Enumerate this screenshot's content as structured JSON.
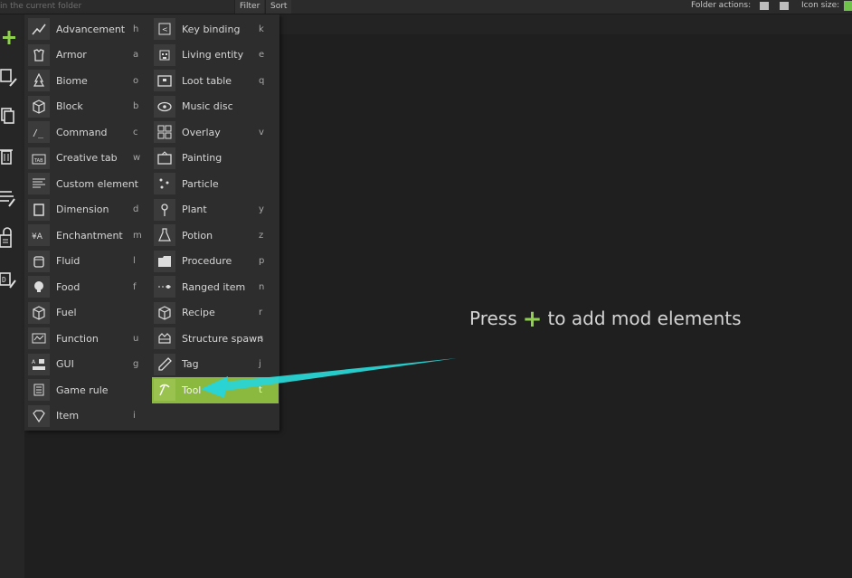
{
  "topbar": {
    "search_placeholder": "in the current folder",
    "filter_label": "Filter",
    "sort_label": "Sort",
    "folder_actions_label": "Folder actions:",
    "icon_size_label": "Icon size:"
  },
  "left_toolbar": [
    {
      "name": "add-element-button",
      "icon": "plus-icon"
    },
    {
      "name": "edit-element-button",
      "icon": "edit-icon"
    },
    {
      "name": "duplicate-element-button",
      "icon": "duplicate-icon"
    },
    {
      "name": "delete-element-button",
      "icon": "trash-icon"
    },
    {
      "name": "rename-element-button",
      "icon": "rename-icon"
    },
    {
      "name": "lock-element-button",
      "icon": "lock-icon"
    },
    {
      "name": "code-element-button",
      "icon": "code-icon"
    }
  ],
  "menu": {
    "left": [
      {
        "label": "Advancement",
        "key": "h",
        "icon": "advancement-icon"
      },
      {
        "label": "Armor",
        "key": "a",
        "icon": "armor-icon"
      },
      {
        "label": "Biome",
        "key": "o",
        "icon": "biome-icon"
      },
      {
        "label": "Block",
        "key": "b",
        "icon": "block-icon"
      },
      {
        "label": "Command",
        "key": "c",
        "icon": "command-icon"
      },
      {
        "label": "Creative tab",
        "key": "w",
        "icon": "creative-tab-icon"
      },
      {
        "label": "Custom element",
        "key": "",
        "icon": "custom-element-icon"
      },
      {
        "label": "Dimension",
        "key": "d",
        "icon": "dimension-icon"
      },
      {
        "label": "Enchantment",
        "key": "m",
        "icon": "enchantment-icon"
      },
      {
        "label": "Fluid",
        "key": "l",
        "icon": "fluid-icon"
      },
      {
        "label": "Food",
        "key": "f",
        "icon": "food-icon"
      },
      {
        "label": "Fuel",
        "key": "",
        "icon": "fuel-icon"
      },
      {
        "label": "Function",
        "key": "u",
        "icon": "function-icon"
      },
      {
        "label": "GUI",
        "key": "g",
        "icon": "gui-icon"
      },
      {
        "label": "Game rule",
        "key": "",
        "icon": "game-rule-icon"
      },
      {
        "label": "Item",
        "key": "i",
        "icon": "item-icon"
      }
    ],
    "right": [
      {
        "label": "Key binding",
        "key": "k",
        "icon": "key-binding-icon"
      },
      {
        "label": "Living entity",
        "key": "e",
        "icon": "living-entity-icon"
      },
      {
        "label": "Loot table",
        "key": "q",
        "icon": "loot-table-icon"
      },
      {
        "label": "Music disc",
        "key": "",
        "icon": "music-disc-icon"
      },
      {
        "label": "Overlay",
        "key": "v",
        "icon": "overlay-icon"
      },
      {
        "label": "Painting",
        "key": "",
        "icon": "painting-icon"
      },
      {
        "label": "Particle",
        "key": "",
        "icon": "particle-icon"
      },
      {
        "label": "Plant",
        "key": "y",
        "icon": "plant-icon"
      },
      {
        "label": "Potion",
        "key": "z",
        "icon": "potion-icon"
      },
      {
        "label": "Procedure",
        "key": "p",
        "icon": "procedure-icon"
      },
      {
        "label": "Ranged item",
        "key": "n",
        "icon": "ranged-item-icon"
      },
      {
        "label": "Recipe",
        "key": "r",
        "icon": "recipe-icon"
      },
      {
        "label": "Structure spawn",
        "key": "s",
        "icon": "structure-spawn-icon"
      },
      {
        "label": "Tag",
        "key": "j",
        "icon": "tag-icon"
      },
      {
        "label": "Tool",
        "key": "t",
        "icon": "tool-icon",
        "active": true
      }
    ]
  },
  "hint": {
    "before": "Press",
    "plus": "+",
    "after": "to add mod elements"
  },
  "colors": {
    "accent": "#8fd14f",
    "active_item": "#8bb83e",
    "arrow": "#2ad4d4"
  }
}
